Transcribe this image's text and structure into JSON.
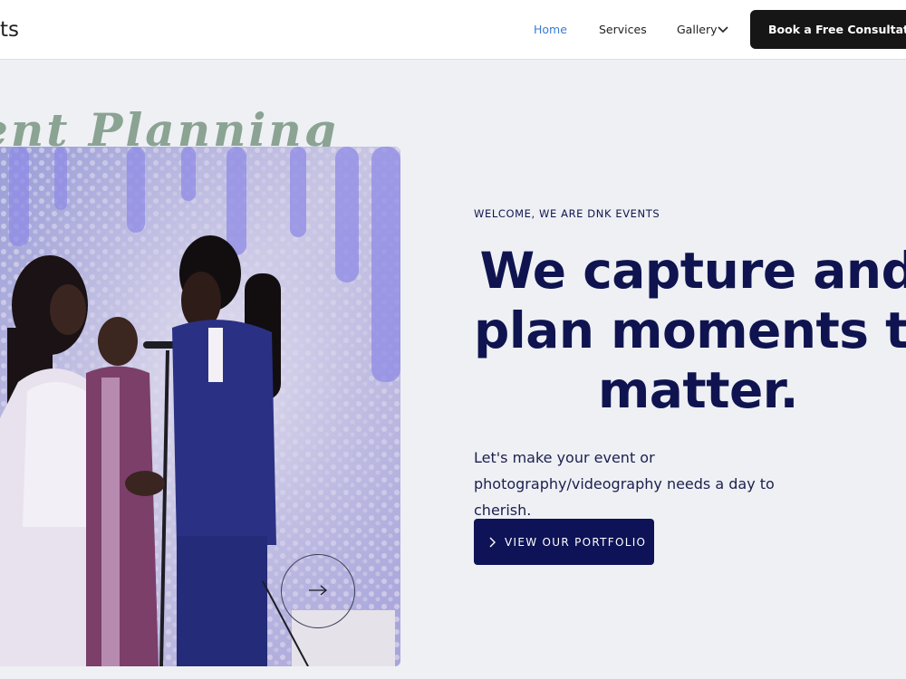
{
  "header": {
    "logo_text": "ts",
    "nav": {
      "home": "Home",
      "services": "Services",
      "gallery": "Gallery"
    },
    "cta_label": "Book a Free Consultation",
    "active_color": "#3a7bd5"
  },
  "hero": {
    "script_title": "vent Planning",
    "eyebrow": "WELCOME, WE ARE DNK EVENTS",
    "headline": {
      "line1": "We capture and",
      "line2": "plan moments that",
      "line3": "matter."
    },
    "subtext": "Let's make your event or photography/videography needs a day to cherish.",
    "button_label": "VIEW OUR PORTFOLIO",
    "button_color": "#0e1357"
  },
  "icons": {
    "gallery_dropdown": "chevron-down-icon",
    "portfolio_chevron": "chevron-right-icon",
    "slider_next": "arrow-right-icon"
  }
}
